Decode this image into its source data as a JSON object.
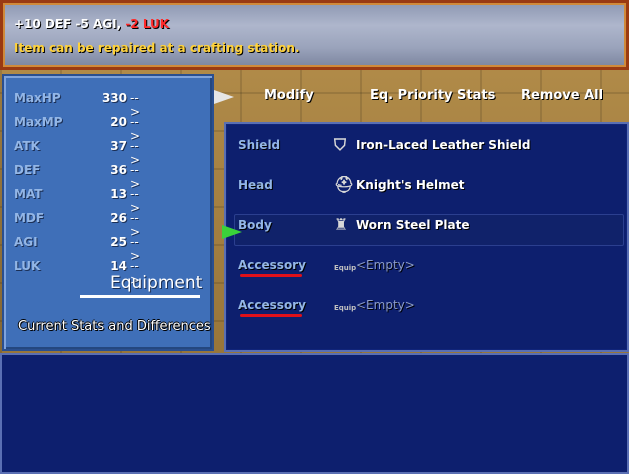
{
  "help": {
    "stat_changes": "+10 DEF -5 AGI,",
    "stat_negative": "-2 LUK",
    "message": "Item can be repaired at a crafting station."
  },
  "status": {
    "stats": [
      {
        "name": "MaxHP",
        "value": "330",
        "arrow": "-->"
      },
      {
        "name": "MaxMP",
        "value": "20",
        "arrow": "-->"
      },
      {
        "name": "ATK",
        "value": "37",
        "arrow": "-->"
      },
      {
        "name": "DEF",
        "value": "36",
        "arrow": "-->"
      },
      {
        "name": "MAT",
        "value": "13",
        "arrow": "-->"
      },
      {
        "name": "MDF",
        "value": "26",
        "arrow": "-->"
      },
      {
        "name": "AGI",
        "value": "25",
        "arrow": "-->"
      },
      {
        "name": "LUK",
        "value": "14",
        "arrow": "-->"
      }
    ],
    "equipment_label": "Equipment",
    "caption": "Current Stats and Differences"
  },
  "commands": {
    "modify": "Modify",
    "priority": "Eq. Priority Stats",
    "remove_all": "Remove All"
  },
  "slots": [
    {
      "name": "Shield",
      "item": "Iron-Laced Leather Shield",
      "icon": "shield-icon"
    },
    {
      "name": "Head",
      "item": "Knight's Helmet",
      "icon": "helmet-icon"
    },
    {
      "name": "Body",
      "item": "Worn Steel Plate",
      "icon": "armor-icon"
    },
    {
      "name": "Accessory",
      "item": "<Empty>",
      "tiny": "Equip"
    },
    {
      "name": "Accessory",
      "item": "<Empty>",
      "tiny": "Equip"
    }
  ],
  "colors": {
    "accent_red": "#e0101a",
    "cursor_green": "#3ad23a"
  }
}
